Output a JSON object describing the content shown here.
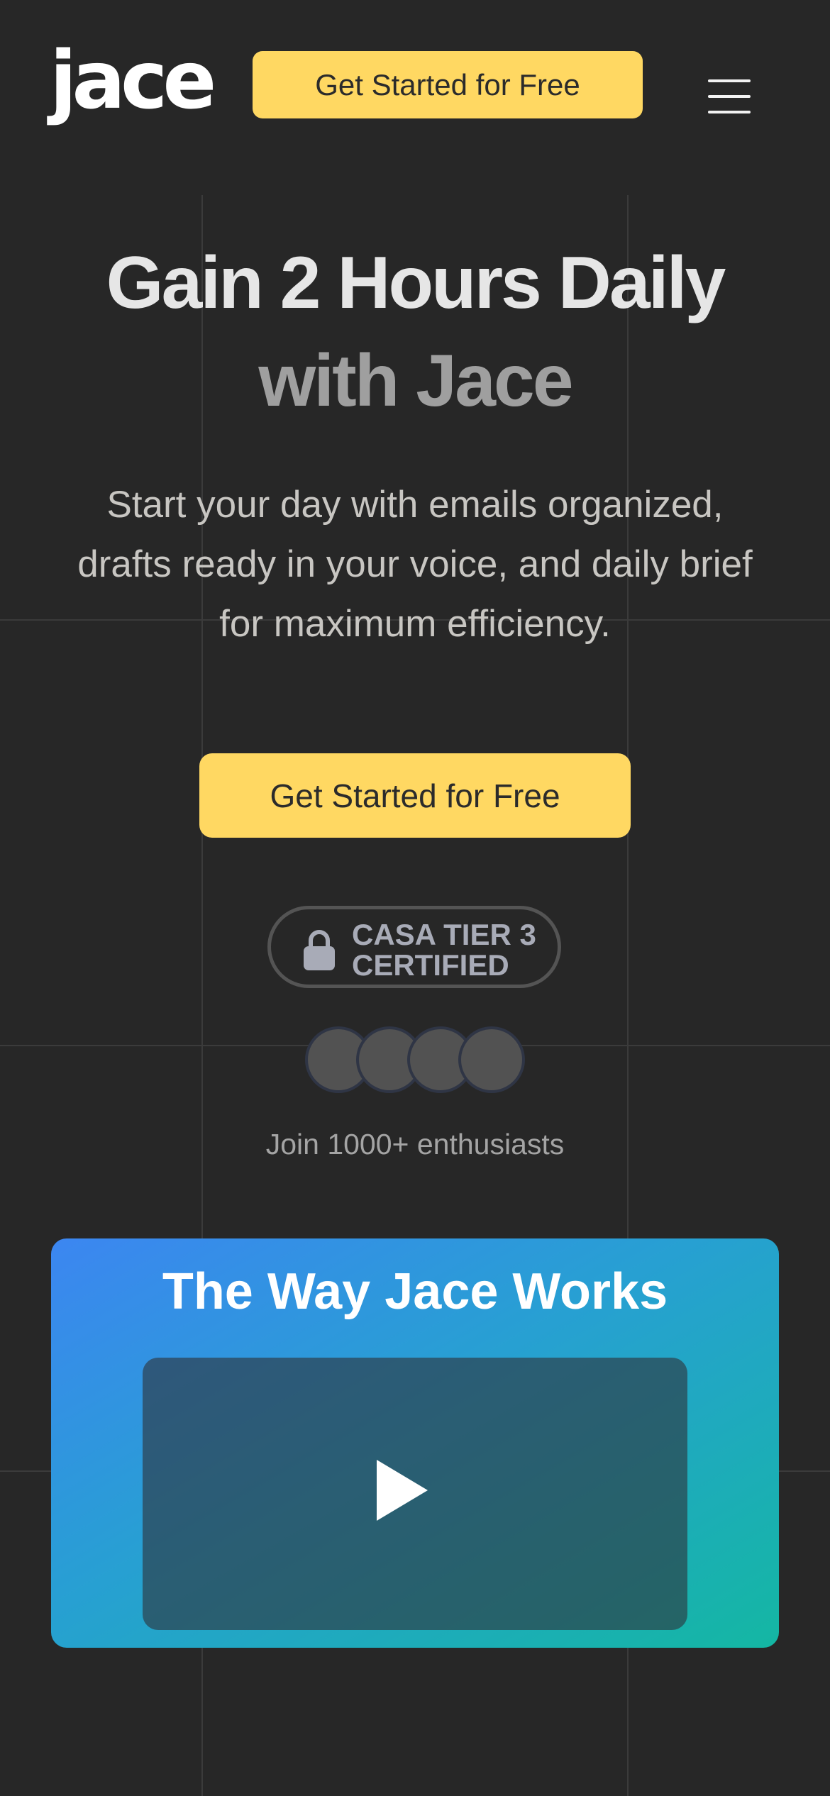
{
  "header": {
    "logo": "jace",
    "cta_label": "Get Started for Free",
    "menu_icon": "hamburger-menu-icon"
  },
  "hero": {
    "title_line1": "Gain 2 Hours Daily",
    "title_line2": "with Jace",
    "subtitle": "Start your day with emails organized, drafts ready in your voice, and daily brief for maximum efficiency.",
    "cta_label": "Get Started for Free"
  },
  "badge": {
    "icon": "lock-icon",
    "line1": "CASA TIER 3",
    "line2": "CERTIFIED"
  },
  "social_proof": {
    "avatar_count": 4,
    "text": "Join 1000+ enthusiasts"
  },
  "video": {
    "title": "The Way Jace Works",
    "play_icon": "play-icon"
  },
  "colors": {
    "background": "#272727",
    "accent_yellow": "#ffd862",
    "gradient_start": "#3c86f1",
    "gradient_end": "#14b7a3"
  }
}
